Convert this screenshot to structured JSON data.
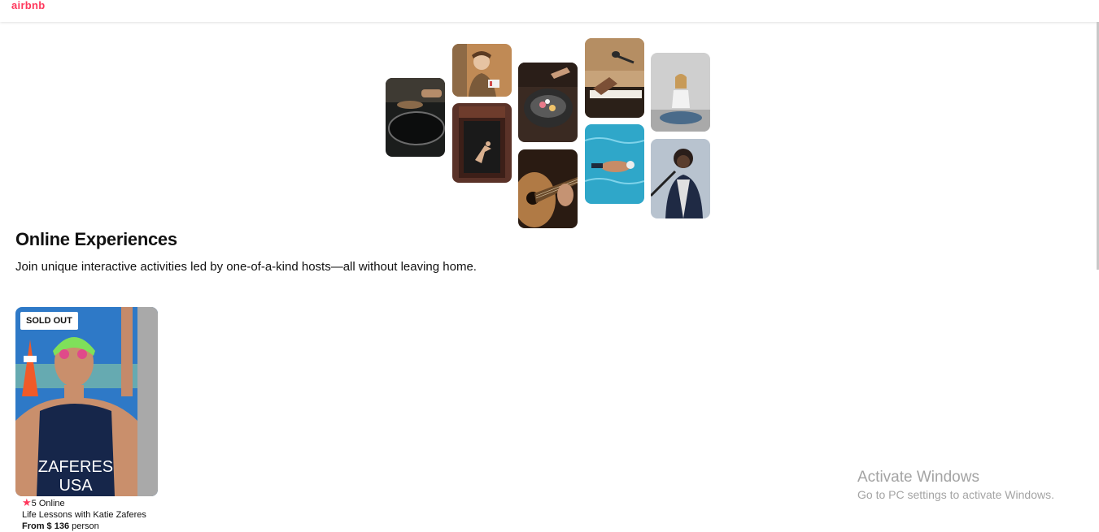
{
  "header": {
    "logo_text": "airbnb",
    "brand_color": "#ff385c"
  },
  "collage": {
    "tiles": [
      {
        "name": "cooking-pan-photo",
        "dominant_color": "#1b1d1c"
      },
      {
        "name": "barista-photo",
        "dominant_color": "#c08a55"
      },
      {
        "name": "doorway-dancer-photo",
        "dominant_color": "#5a3228"
      },
      {
        "name": "food-bowl-photo",
        "dominant_color": "#3a2a22"
      },
      {
        "name": "guitar-photo",
        "dominant_color": "#2a1b12"
      },
      {
        "name": "piano-singer-photo",
        "dominant_color": "#c7a37a"
      },
      {
        "name": "swimmer-photo",
        "dominant_color": "#2fa7c9"
      },
      {
        "name": "yoga-photo",
        "dominant_color": "#cfcfcf"
      },
      {
        "name": "singer-mic-photo",
        "dominant_color": "#b8c3cf"
      }
    ]
  },
  "main": {
    "title": "Online Experiences",
    "subtitle": "Join unique interactive activities led by one-of-a-kind hosts—all without leaving home."
  },
  "card": {
    "badge": "SOLD OUT",
    "rating": "5",
    "location": "Online",
    "title": "Life Lessons with Katie Zaferes",
    "price_prefix": "From $ 136",
    "price_suffix": " person",
    "jersey_line1": "ZAFERES",
    "jersey_line2": "USA"
  },
  "watermark": {
    "title": "Activate Windows",
    "subtitle": "Go to PC settings to activate Windows."
  }
}
